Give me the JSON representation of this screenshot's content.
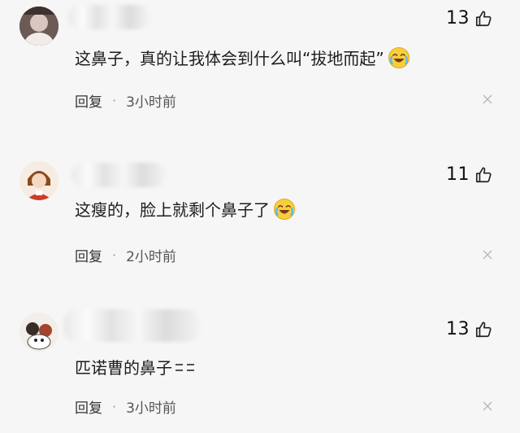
{
  "comments": [
    {
      "likes": "13",
      "text": "这鼻子，真的让我体会到什么叫“拔地而起”",
      "emoji": "crying-laughing-emoji",
      "reply": "回复",
      "time": "3小时前"
    },
    {
      "likes": "11",
      "text": "这瘦的，脸上就剩个鼻子了",
      "emoji": "crying-laughing-emoji",
      "reply": "回复",
      "time": "2小时前"
    },
    {
      "likes": "13",
      "text": "匹诺曹的鼻子",
      "emoji": "",
      "reply": "回复",
      "time": "3小时前"
    }
  ],
  "icons": {
    "like": "thumbs-up-icon",
    "close": "close-icon"
  },
  "colors": {
    "background": "#f6f6f6",
    "text": "#1d1d1d",
    "muted": "#555555"
  }
}
